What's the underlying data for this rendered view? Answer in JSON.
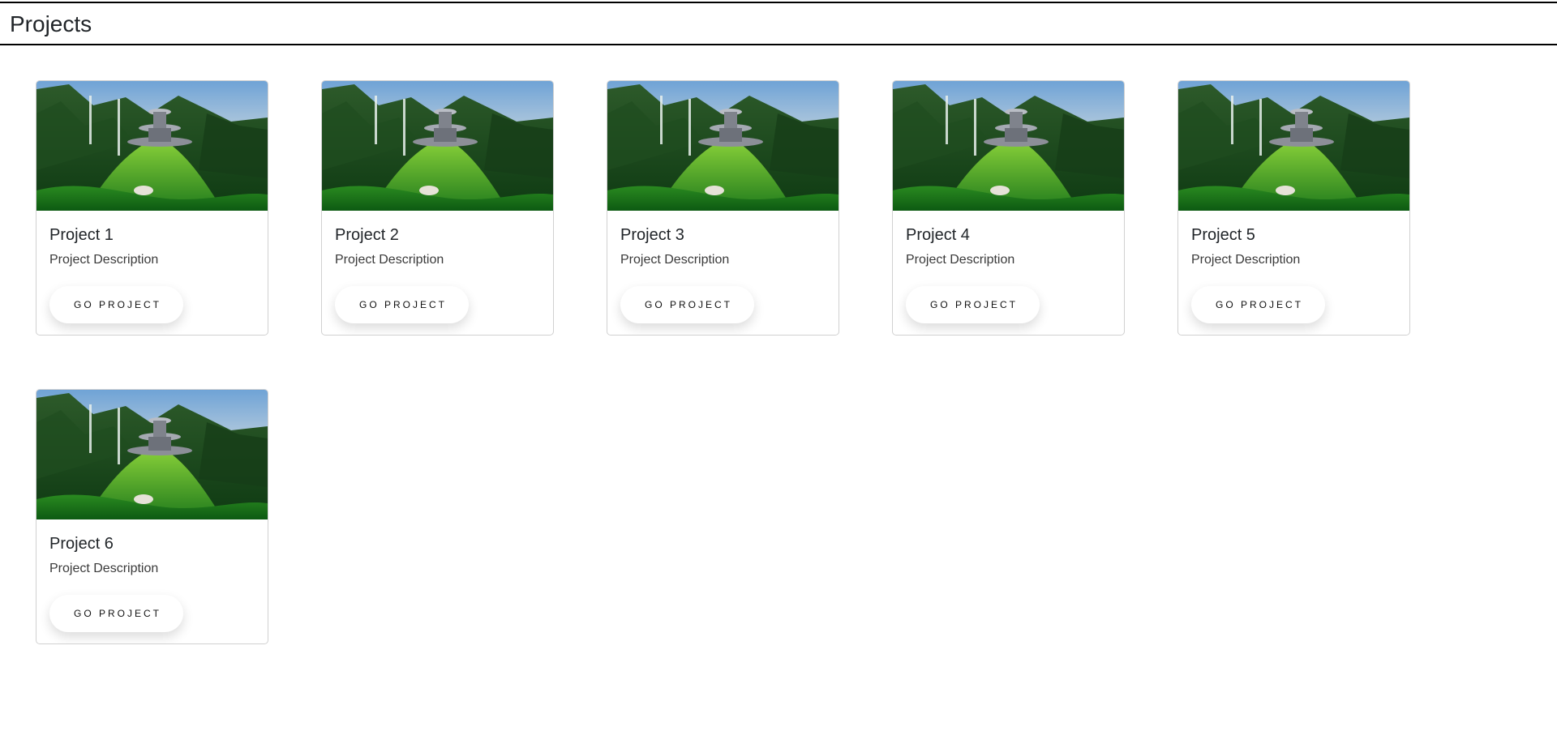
{
  "header": {
    "title": "Projects"
  },
  "projects": [
    {
      "title": "Project 1",
      "description": "Project Description",
      "button_label": "GO PROJECT"
    },
    {
      "title": "Project 2",
      "description": "Project Description",
      "button_label": "GO PROJECT"
    },
    {
      "title": "Project 3",
      "description": "Project Description",
      "button_label": "GO PROJECT"
    },
    {
      "title": "Project 4",
      "description": "Project Description",
      "button_label": "GO PROJECT"
    },
    {
      "title": "Project 5",
      "description": "Project Description",
      "button_label": "GO PROJECT"
    },
    {
      "title": "Project 6",
      "description": "Project Description",
      "button_label": "GO PROJECT"
    }
  ],
  "colors": {
    "background": "#ffffff",
    "text": "#212529",
    "border": "#d0d0d0",
    "header_rule": "#000000"
  },
  "icons": {
    "card_image": "landscape-image"
  }
}
